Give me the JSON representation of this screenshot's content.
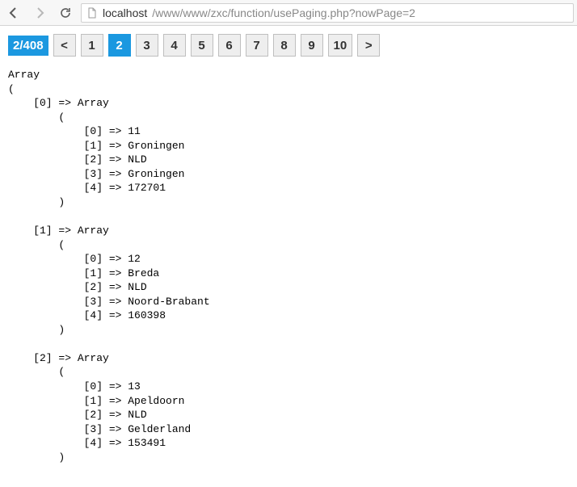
{
  "browser": {
    "url_host": "localhost",
    "url_path": "/www/www/zxc/function/usePaging.php?nowPage=2"
  },
  "pagination": {
    "badge": "2/408",
    "prev_label": "<",
    "next_label": ">",
    "pages": [
      "1",
      "2",
      "3",
      "4",
      "5",
      "6",
      "7",
      "8",
      "9",
      "10"
    ],
    "active_index": 1
  },
  "dump": {
    "header": "Array",
    "rows": [
      {
        "idx": "0",
        "values": [
          "11",
          "Groningen",
          "NLD",
          "Groningen",
          "172701"
        ]
      },
      {
        "idx": "1",
        "values": [
          "12",
          "Breda",
          "NLD",
          "Noord-Brabant",
          "160398"
        ]
      },
      {
        "idx": "2",
        "values": [
          "13",
          "Apeldoorn",
          "NLD",
          "Gelderland",
          "153491"
        ]
      }
    ]
  }
}
